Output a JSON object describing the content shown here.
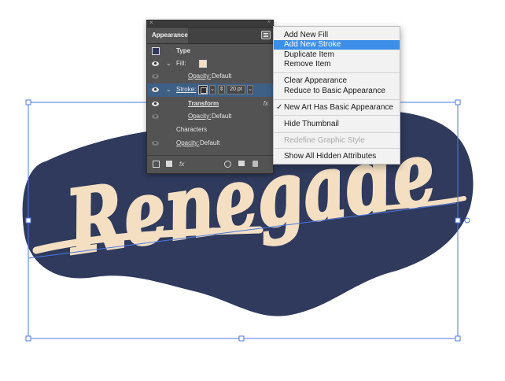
{
  "artwork": {
    "word": "Renegade",
    "fill_color": "#f4dfc3",
    "stroke_color": "#2f3a5c",
    "selection_color": "#4d79e3"
  },
  "panel": {
    "title": "Appearance",
    "rows": {
      "type_label": "Type",
      "fill_label": "Fill:",
      "opacity_fill": "Opacity:",
      "opacity_fill_value": "Default",
      "stroke_label": "Stroke:",
      "stroke_weight": "20 pt",
      "transform_label": "Transform",
      "opacity_stroke": "Opacity:",
      "opacity_stroke_value": "Default",
      "characters_label": "Characters",
      "opacity_char": "Opacity:",
      "opacity_char_value": "Default"
    },
    "fx_label": "fx"
  },
  "menu": {
    "items": [
      "Add New Fill",
      "Add New Stroke",
      "Duplicate Item",
      "Remove Item",
      "Clear Appearance",
      "Reduce to Basic Appearance",
      "New Art Has Basic Appearance",
      "Hide Thumbnail",
      "Redefine Graphic Style",
      "Show All Hidden Attributes"
    ],
    "highlighted": "Add New Stroke",
    "checked": "New Art Has Basic Appearance",
    "disabled": "Redefine Graphic Style"
  }
}
